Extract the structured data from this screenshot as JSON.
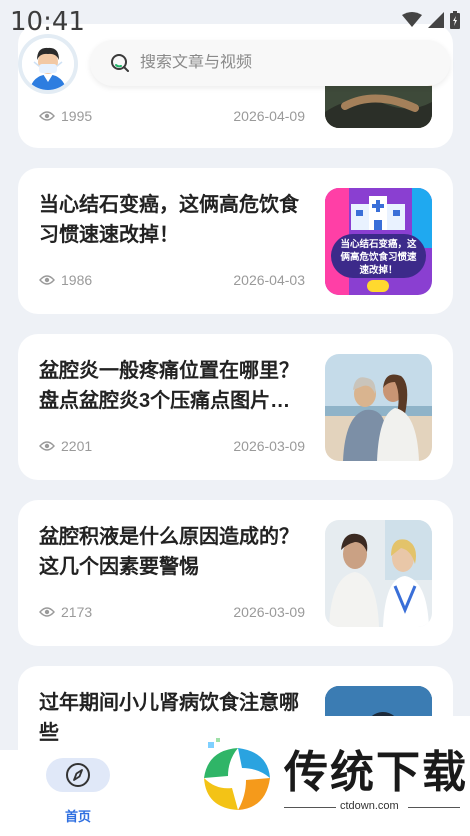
{
  "status_bar": {
    "time": "10:41"
  },
  "search": {
    "placeholder": "搜索文章与视频"
  },
  "articles": [
    {
      "title": "",
      "views": "1995",
      "date": "2026-04-09"
    },
    {
      "title": "当心结石变癌，这俩高危饮食习惯速速改掉！",
      "views": "1986",
      "date": "2026-04-03",
      "thumb_text": "当心结石变癌，这俩高危饮食习惯速速改掉！"
    },
    {
      "title": "盆腔炎一般疼痛位置在哪里？盘点盆腔炎3个压痛点图片…",
      "views": "2201",
      "date": "2026-03-09"
    },
    {
      "title": "盆腔积液是什么原因造成的？这几个因素要警惕",
      "views": "2173",
      "date": "2026-03-09"
    },
    {
      "title": "过年期间小儿肾病饮食注意哪些",
      "views": "",
      "date": ""
    }
  ],
  "tabbar": {
    "home_label": "首页"
  },
  "watermark": {
    "title": "传统下载",
    "url": "ctdown.com"
  },
  "colors": {
    "accent": "#2f6fe0",
    "background": "#eef1f6"
  }
}
